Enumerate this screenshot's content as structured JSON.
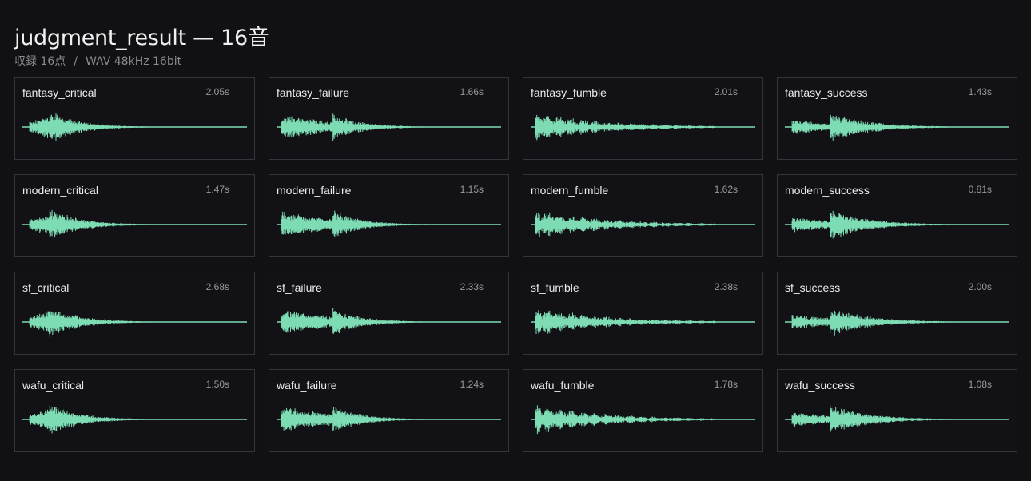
{
  "header": {
    "title": "judgment_result — 16音",
    "subtitle_count": "収録 16点",
    "subtitle_sep": "/",
    "subtitle_format": "WAV 48kHz 16bit"
  },
  "colors": {
    "background": "#111114",
    "card_border": "#34343a",
    "waveform": "#7ddcb4"
  },
  "sounds": [
    {
      "name": "fantasy_critical",
      "duration": "2.05s",
      "shape": "critical"
    },
    {
      "name": "fantasy_failure",
      "duration": "1.66s",
      "shape": "failure"
    },
    {
      "name": "fantasy_fumble",
      "duration": "2.01s",
      "shape": "fumble"
    },
    {
      "name": "fantasy_success",
      "duration": "1.43s",
      "shape": "success"
    },
    {
      "name": "modern_critical",
      "duration": "1.47s",
      "shape": "critical"
    },
    {
      "name": "modern_failure",
      "duration": "1.15s",
      "shape": "failure"
    },
    {
      "name": "modern_fumble",
      "duration": "1.62s",
      "shape": "fumble"
    },
    {
      "name": "modern_success",
      "duration": "0.81s",
      "shape": "success"
    },
    {
      "name": "sf_critical",
      "duration": "2.68s",
      "shape": "critical"
    },
    {
      "name": "sf_failure",
      "duration": "2.33s",
      "shape": "failure"
    },
    {
      "name": "sf_fumble",
      "duration": "2.38s",
      "shape": "fumble"
    },
    {
      "name": "sf_success",
      "duration": "2.00s",
      "shape": "success"
    },
    {
      "name": "wafu_critical",
      "duration": "1.50s",
      "shape": "critical"
    },
    {
      "name": "wafu_failure",
      "duration": "1.24s",
      "shape": "failure"
    },
    {
      "name": "wafu_fumble",
      "duration": "1.78s",
      "shape": "fumble"
    },
    {
      "name": "wafu_success",
      "duration": "1.08s",
      "shape": "success"
    }
  ]
}
